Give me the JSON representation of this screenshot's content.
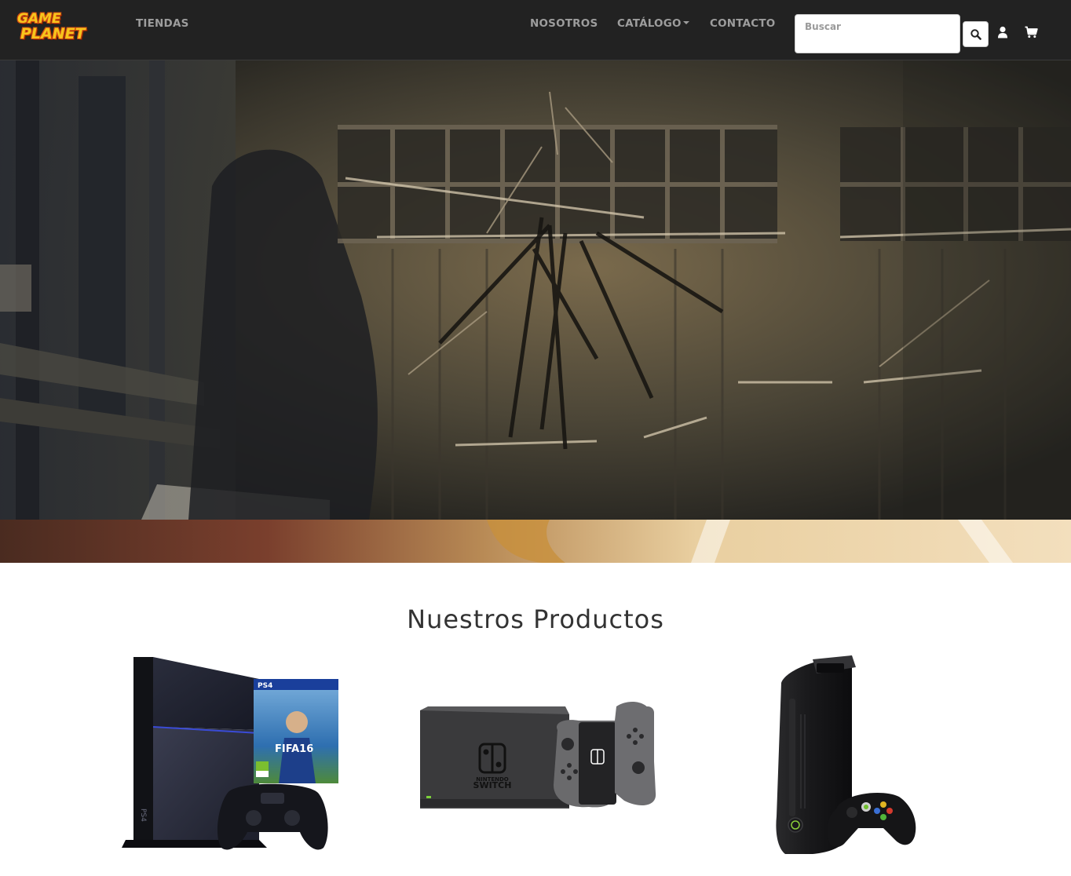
{
  "brand": {
    "line1": "GAME",
    "line2": "PLANET",
    "colors": {
      "fill": "#f7c51c",
      "outline": "#d14b12"
    }
  },
  "nav": {
    "left": [
      {
        "label": "TIENDAS"
      }
    ],
    "right": [
      {
        "label": "NOSOTROS"
      },
      {
        "label": "CATÁLOGO",
        "dropdown": true
      },
      {
        "label": "CONTACTO"
      }
    ]
  },
  "search": {
    "placeholder": "Buscar",
    "value": "",
    "button_icon": "search-icon"
  },
  "nav_icons": {
    "user": "user-icon",
    "cart": "shopping-cart-icon"
  },
  "hero": {
    "carousel_icon": "hero-image"
  },
  "products_section": {
    "title": "Nuestros Productos",
    "items": [
      {
        "name": "ps4-bundle",
        "box_label": "PS4",
        "game_label": "FIFA16"
      },
      {
        "name": "nintendo-switch",
        "logo_text": "NINTENDO SWITCH"
      },
      {
        "name": "xbox-360-elite"
      }
    ]
  },
  "colors": {
    "navbar_bg": "#222222",
    "nav_text": "#9d9d9d",
    "page_bg": "#ffffff",
    "title": "#333333"
  }
}
